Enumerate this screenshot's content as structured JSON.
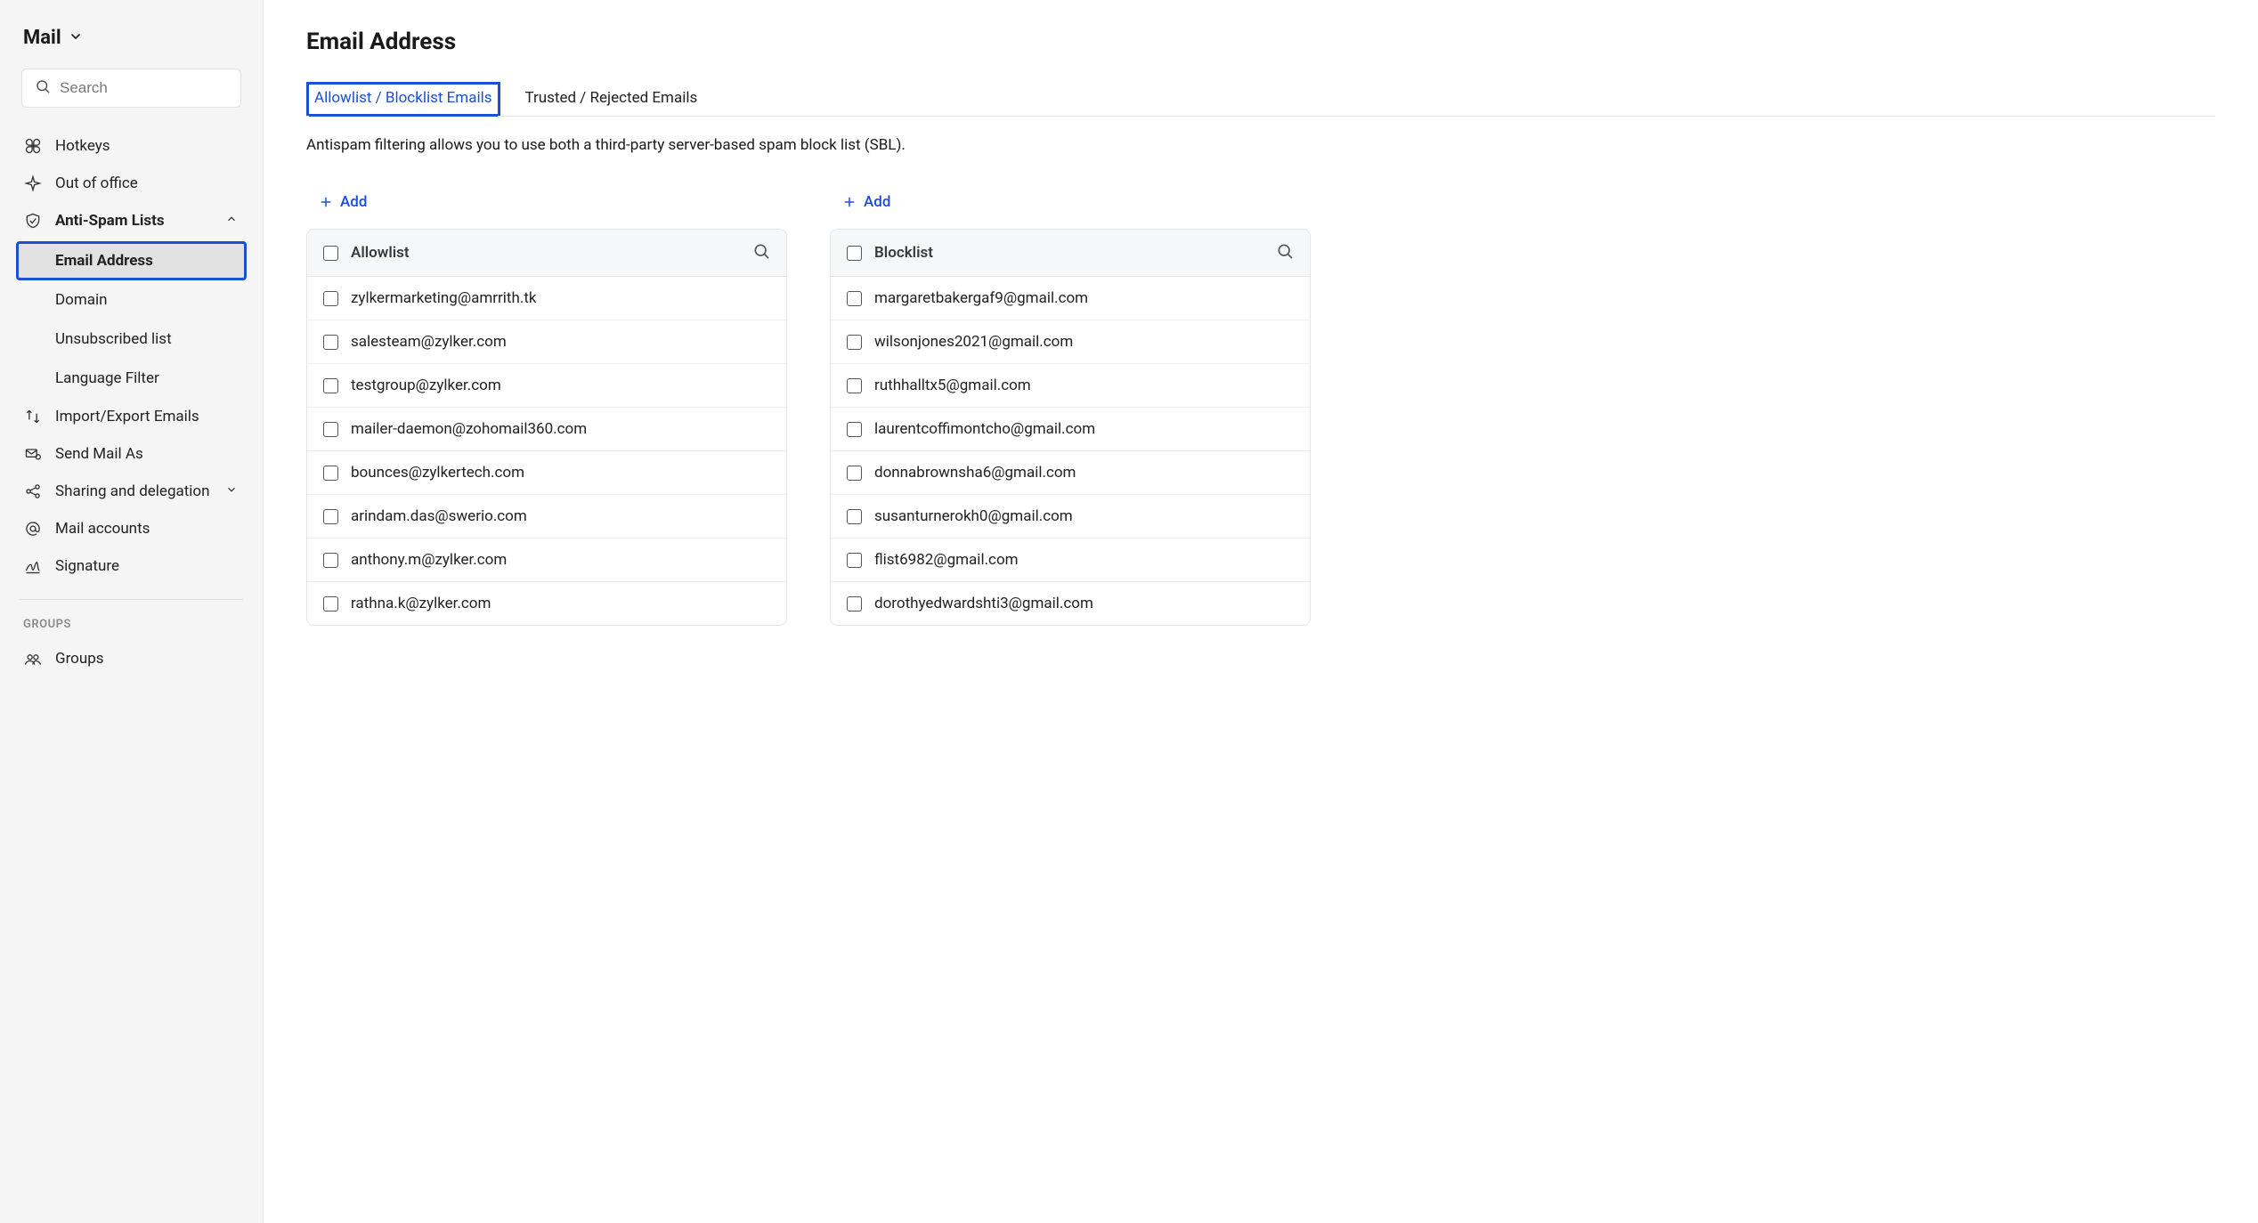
{
  "sidebar": {
    "title": "Mail",
    "search_placeholder": "Search",
    "items": [
      {
        "icon": "command",
        "label": "Hotkeys",
        "expandable": false
      },
      {
        "icon": "plane",
        "label": "Out of office",
        "expandable": false
      },
      {
        "icon": "shield",
        "label": "Anti-Spam Lists",
        "expandable": true,
        "expanded": true,
        "bold": true,
        "children": [
          {
            "label": "Email Address",
            "active": true
          },
          {
            "label": "Domain"
          },
          {
            "label": "Unsubscribed list"
          },
          {
            "label": "Language Filter"
          }
        ]
      },
      {
        "icon": "importexport",
        "label": "Import/Export Emails",
        "expandable": false
      },
      {
        "icon": "sendas",
        "label": "Send Mail As",
        "expandable": false
      },
      {
        "icon": "share",
        "label": "Sharing and delegation",
        "expandable": true,
        "expanded": false
      },
      {
        "icon": "at",
        "label": "Mail accounts",
        "expandable": false
      },
      {
        "icon": "signature",
        "label": "Signature",
        "expandable": false
      }
    ],
    "groups_heading": "GROUPS",
    "groups_item": "Groups"
  },
  "page": {
    "title": "Email Address",
    "tabs": [
      {
        "label": "Allowlist / Blocklist Emails",
        "active": true
      },
      {
        "label": "Trusted / Rejected Emails",
        "active": false
      }
    ],
    "description": "Antispam filtering allows you to use both a third-party server-based spam block list (SBL).",
    "add_label": "Add"
  },
  "allowlist": {
    "title": "Allowlist",
    "rows": [
      "zylkermarketing@amrrith.tk",
      "salesteam@zylker.com",
      "testgroup@zylker.com",
      "mailer-daemon@zohomail360.com",
      "bounces@zylkertech.com",
      "arindam.das@swerio.com",
      "anthony.m@zylker.com",
      "rathna.k@zylker.com"
    ]
  },
  "blocklist": {
    "title": "Blocklist",
    "rows": [
      "margaretbakergaf9@gmail.com",
      "wilsonjones2021@gmail.com",
      "ruthhalltx5@gmail.com",
      "laurentcoffimontcho@gmail.com",
      "donnabrownsha6@gmail.com",
      "susanturnerokh0@gmail.com",
      "flist6982@gmail.com",
      "dorothyedwardshti3@gmail.com"
    ]
  }
}
